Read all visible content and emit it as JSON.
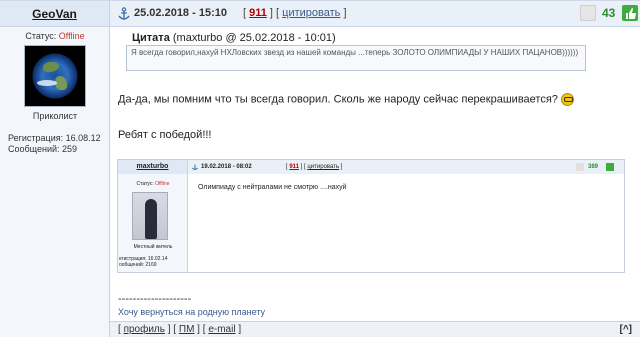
{
  "post": {
    "author": "GeoVan",
    "date": "25.02.2018 - 15:10",
    "post_number": "911",
    "quote_action": "цитировать",
    "rating": "43",
    "status_label": "Статус:",
    "status_value": "Offline",
    "rank": "Приколист",
    "registration": "Регистрация: 16.08.12",
    "messages": "Сообщений: 259"
  },
  "quote": {
    "label": "Цитата",
    "source": "(maxturbo @ 25.02.2018 - 10:01)",
    "text": "Я всегда говорил,нахуй НХЛовских звезд из нашей команды ...теперь ЗОЛОТО ОЛИМПИАДЫ У НАШИХ ПАЦАНОВ))))))"
  },
  "body": {
    "line1": "Да-да, мы помним что ты всегда говорил. Сколь же народу сейчас перекрашивается?",
    "line2": "Ребят с победой!!!"
  },
  "embedded_post": {
    "author": "maxturbo",
    "date": "19.02.2018 - 08:02",
    "post_number": "911",
    "quote_action": "цитировать",
    "rating": "389",
    "status_label": "Статус:",
    "status_value": "Offline",
    "rank": "Местный житель",
    "registration": "егистрация: 16.02.14",
    "messages": "ообщений: 2169",
    "text": "Олимпиаду с нейтралами не смотрю ....нахуй"
  },
  "signature": {
    "divider": "--------------------",
    "text": "Хочу вернуться на родную планету"
  },
  "footer": {
    "profile": "профиль",
    "pm": "ПМ",
    "email": "e-mail",
    "to_top": "[^]"
  },
  "colors": {
    "header_bg": "#eaf0f8",
    "offline": "#c0392b",
    "post_number": "#b00000",
    "rating": "#2e8b2e"
  }
}
